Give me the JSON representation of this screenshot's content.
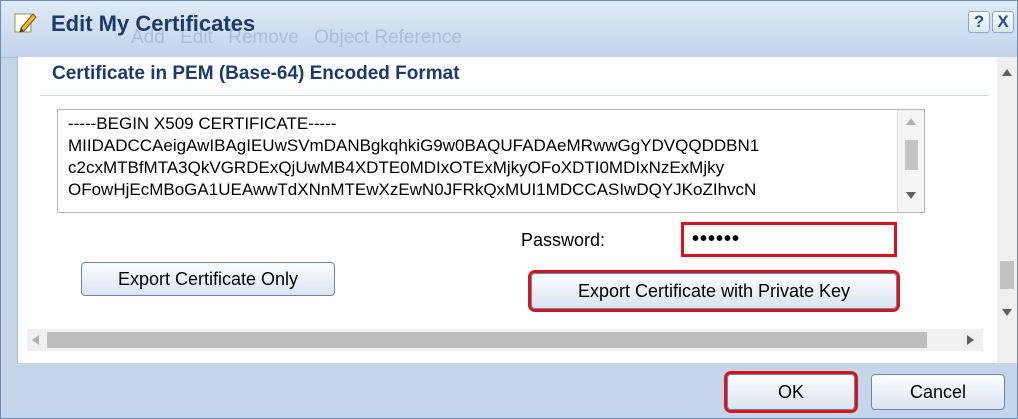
{
  "dialog": {
    "title": "Edit My Certificates",
    "help_label": "?",
    "close_label": "X",
    "background_toolbar": [
      "Add",
      "Edit",
      "Remove",
      "Object Reference"
    ]
  },
  "section": {
    "title": "Certificate in PEM (Base-64) Encoded Format"
  },
  "pem": {
    "lines": [
      "-----BEGIN X509 CERTIFICATE-----",
      "MIIDADCCAeigAwIBAgIEUwSVmDANBgkqhkiG9w0BAQUFADAeMRwwGgYDVQQDDBN1",
      "c2cxMTBfMTA3QkVGRDExQjUwMB4XDTE0MDIxOTExMjkyOFoXDTI0MDIxNzExMjky",
      "OFowHjEcMBoGA1UEAwwTdXNnMTEwXzEwN0JFRkQxMUI1MDCCASIwDQYJKoZIhvcN"
    ]
  },
  "password": {
    "label": "Password:",
    "value": "••••••"
  },
  "buttons": {
    "export_only": "Export Certificate Only",
    "export_with_key": "Export Certificate with Private Key",
    "ok": "OK",
    "cancel": "Cancel"
  },
  "colors": {
    "highlight": "#d6141e",
    "title_text": "#1c3a6a",
    "frame": "#c5d6ea"
  },
  "icons": {
    "title": "edit-pencil-icon",
    "help": "help-icon",
    "close": "close-icon"
  }
}
